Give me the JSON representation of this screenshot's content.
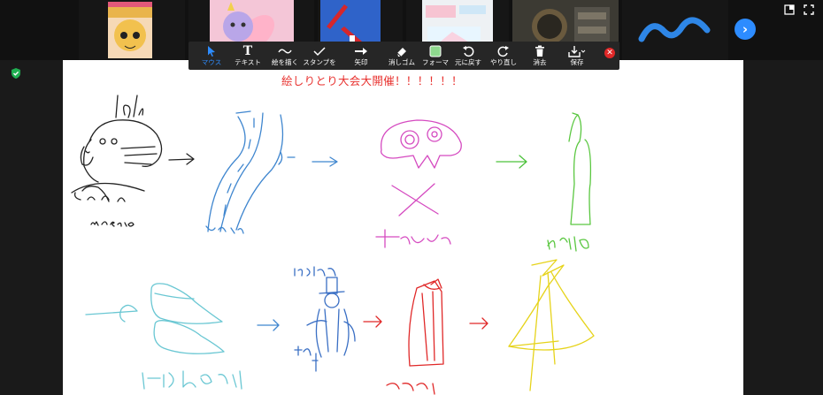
{
  "annotation_toolbar": {
    "tools": [
      {
        "key": "mouse",
        "label": "マウス",
        "icon": "cursor-icon",
        "active": true
      },
      {
        "key": "text",
        "label": "テキスト",
        "icon": "text-T-icon"
      },
      {
        "key": "draw",
        "label": "絵を描く",
        "icon": "squiggle-icon"
      },
      {
        "key": "stamp",
        "label": "スタンプを",
        "icon": "checkmark-icon"
      },
      {
        "key": "arrow",
        "label": "矢印",
        "icon": "arrow-right-icon"
      },
      {
        "key": "eraser",
        "label": "消しゴム",
        "icon": "eraser-icon"
      },
      {
        "key": "format",
        "label": "フォーマ",
        "icon": "color-swatch-icon"
      },
      {
        "key": "undo",
        "label": "元に戻す",
        "icon": "undo-icon"
      },
      {
        "key": "redo",
        "label": "やり直し",
        "icon": "redo-icon"
      },
      {
        "key": "clear",
        "label": "消去",
        "icon": "trash-icon"
      },
      {
        "key": "save",
        "label": "保存",
        "icon": "download-icon"
      }
    ],
    "close_icon": "close-x-icon"
  },
  "whiteboard": {
    "title": "絵しりとり大会大開催！！！！！！",
    "title_color": "#e8322f",
    "signatures": [
      "masato",
      "Kazuya",
      "Hohiya",
      "ysaito",
      "r-ishibashi",
      "koshida",
      "asai"
    ]
  },
  "strip": {
    "next_icon": "chevron-right-icon"
  },
  "colors": {
    "accent": "#2d8cff",
    "close": "#e02828",
    "toolbar_bg": "#262626"
  }
}
